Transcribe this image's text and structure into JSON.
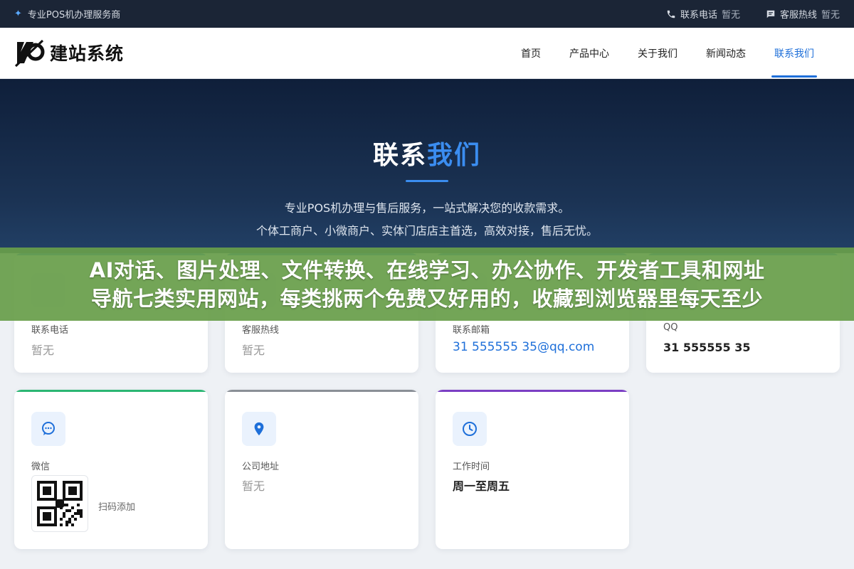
{
  "topbar": {
    "brand": "专业POS机办理服务商",
    "phone_label": "联系电话",
    "phone_value": "暂无",
    "hotline_label": "客服热线",
    "hotline_value": "暂无"
  },
  "header": {
    "logo_text": "建站系统",
    "nav": [
      {
        "label": "首页",
        "active": false
      },
      {
        "label": "产品中心",
        "active": false
      },
      {
        "label": "关于我们",
        "active": false
      },
      {
        "label": "新闻动态",
        "active": false
      },
      {
        "label": "联系我们",
        "active": true
      }
    ]
  },
  "hero": {
    "title_plain": "联系",
    "title_accent": "我们",
    "desc_line1": "专业POS机办理与售后服务，一站式解决您的收款需求。",
    "desc_line2": "个体工商户、小微商户、实体门店店主首选，高效对接，售后无忧。"
  },
  "cards": [
    {
      "label": "联系电话",
      "value": "暂无"
    },
    {
      "label": "客服热线",
      "value": "暂无"
    },
    {
      "label": "联系邮箱",
      "value": "31 555555 35@qq.com"
    },
    {
      "label": "QQ",
      "value": "31 555555 35"
    },
    {
      "label": "微信",
      "hint": "扫码添加",
      "icon": "chat-icon"
    },
    {
      "label": "公司地址",
      "value": "暂无",
      "icon": "location-pin-icon"
    },
    {
      "label": "工作时间",
      "value": "周一至周五",
      "icon": "clock-icon"
    }
  ],
  "banner": {
    "line1": "AI对话、图片处理、文件转换、在线学习、办公协作、开发者工具和网址",
    "line2": "导航七类实用网站，每类挑两个免费又好用的，收藏到浏览器里每天至少"
  },
  "colors": {
    "accent": "#1e6fd9",
    "card_green": "#2bb673",
    "card_gray": "#8a8f96",
    "card_purple": "#7b3fc4",
    "banner": "#689e4a"
  }
}
